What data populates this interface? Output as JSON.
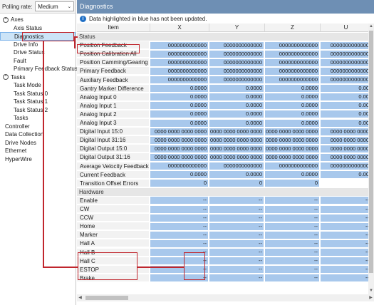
{
  "polling": {
    "label": "Polling rate:",
    "value": "Medium"
  },
  "tree": {
    "axes": {
      "label": "Axes",
      "toggle": "^"
    },
    "axes_children": [
      "Axis Status",
      "Diagnostics",
      "Drive Info",
      "Drive Status",
      "Fault",
      "Primary Feedback Status"
    ],
    "tasks": {
      "label": "Tasks",
      "toggle": "^"
    },
    "tasks_children": [
      "Task Mode",
      "Task Status 0",
      "Task Status 1",
      "Task Status 2",
      "Tasks"
    ],
    "roots": [
      "Controller",
      "Data Collection",
      "Drive Nodes",
      "Ethernet",
      "HyperWire"
    ]
  },
  "panel": {
    "title": "Diagnostics",
    "info": "Data highlighted in blue has not been updated."
  },
  "columns": [
    "Item",
    "X",
    "Y",
    "Z",
    "U"
  ],
  "sections": {
    "status": "Status",
    "hardware": "Hardware"
  },
  "status_rows": [
    {
      "label": "Position Feedback",
      "values": [
        "0000000000000",
        "0000000000000",
        "0000000000000",
        "0000000000000"
      ]
    },
    {
      "label": "Position Calibration All",
      "values": [
        "0000000000000",
        "0000000000000",
        "0000000000000",
        "0000000000000"
      ]
    },
    {
      "label": "Position Camming/Gearing",
      "values": [
        "0000000000000",
        "0000000000000",
        "0000000000000",
        "0000000000000"
      ]
    },
    {
      "label": "Primary Feedback",
      "values": [
        "0000000000000",
        "0000000000000",
        "0000000000000",
        "0000000000000"
      ]
    },
    {
      "label": "Auxiliary Feedback",
      "values": [
        "0000000000000",
        "0000000000000",
        "0000000000000",
        "0000000000000"
      ]
    },
    {
      "label": "Gantry Marker Difference",
      "values": [
        "0.0000",
        "0.0000",
        "0.0000",
        "0.00"
      ]
    },
    {
      "label": "Analog Input 0",
      "values": [
        "0.0000",
        "0.0000",
        "0.0000",
        "0.00"
      ]
    },
    {
      "label": "Analog Input 1",
      "values": [
        "0.0000",
        "0.0000",
        "0.0000",
        "0.00"
      ]
    },
    {
      "label": "Analog Input 2",
      "values": [
        "0.0000",
        "0.0000",
        "0.0000",
        "0.00"
      ]
    },
    {
      "label": "Analog Input 3",
      "values": [
        "0.0000",
        "0.0000",
        "0.0000",
        "0.00"
      ]
    },
    {
      "label": "Digital Input 15:0",
      "values": [
        "0000 0000 0000 0000",
        "0000 0000 0000 0000",
        "0000 0000 0000 0000",
        "0000 0000 0000"
      ]
    },
    {
      "label": "Digital Input 31:16",
      "values": [
        "0000 0000 0000 0000",
        "0000 0000 0000 0000",
        "0000 0000 0000 0000",
        "0000 0000 0000"
      ]
    },
    {
      "label": "Digital Output 15:0",
      "values": [
        "0000 0000 0000 0000",
        "0000 0000 0000 0000",
        "0000 0000 0000 0000",
        "0000 0000 0000"
      ]
    },
    {
      "label": "Digital Output 31:16",
      "values": [
        "0000 0000 0000 0000",
        "0000 0000 0000 0000",
        "0000 0000 0000 0000",
        "0000 0000 0000"
      ]
    },
    {
      "label": "Average Velocity Feedback",
      "values": [
        "0000000000000",
        "0000000000000",
        "0000000000000",
        "0000000000000"
      ]
    },
    {
      "label": "Current Feedback",
      "values": [
        "0.0000",
        "0.0000",
        "0.0000",
        "0.00"
      ]
    },
    {
      "label": "Transition Offset Errors",
      "values": [
        "0",
        "0",
        "0",
        ""
      ]
    }
  ],
  "hardware_rows": [
    {
      "label": "Enable",
      "values": [
        "--",
        "--",
        "--",
        "--"
      ]
    },
    {
      "label": "CW",
      "values": [
        "--",
        "--",
        "--",
        "--"
      ]
    },
    {
      "label": "CCW",
      "values": [
        "--",
        "--",
        "--",
        "--"
      ]
    },
    {
      "label": "Home",
      "values": [
        "--",
        "--",
        "--",
        "--"
      ]
    },
    {
      "label": "Marker",
      "values": [
        "--",
        "--",
        "--",
        "--"
      ]
    },
    {
      "label": "Hall A",
      "values": [
        "--",
        "--",
        "--",
        "--"
      ]
    },
    {
      "label": "Hall B",
      "values": [
        "--",
        "--",
        "--",
        "--"
      ]
    },
    {
      "label": "Hall C",
      "values": [
        "--",
        "--",
        "--",
        "--"
      ]
    },
    {
      "label": "ESTOP",
      "values": [
        "--",
        "--",
        "--",
        "--"
      ]
    },
    {
      "label": "Brake",
      "values": [
        "--",
        "--",
        "--",
        "--"
      ]
    }
  ],
  "colors": {
    "header": "#6e8fb4",
    "stale_cell": "#a8c8ec",
    "annotation": "#c0262d",
    "selected": "#cce4f7"
  }
}
